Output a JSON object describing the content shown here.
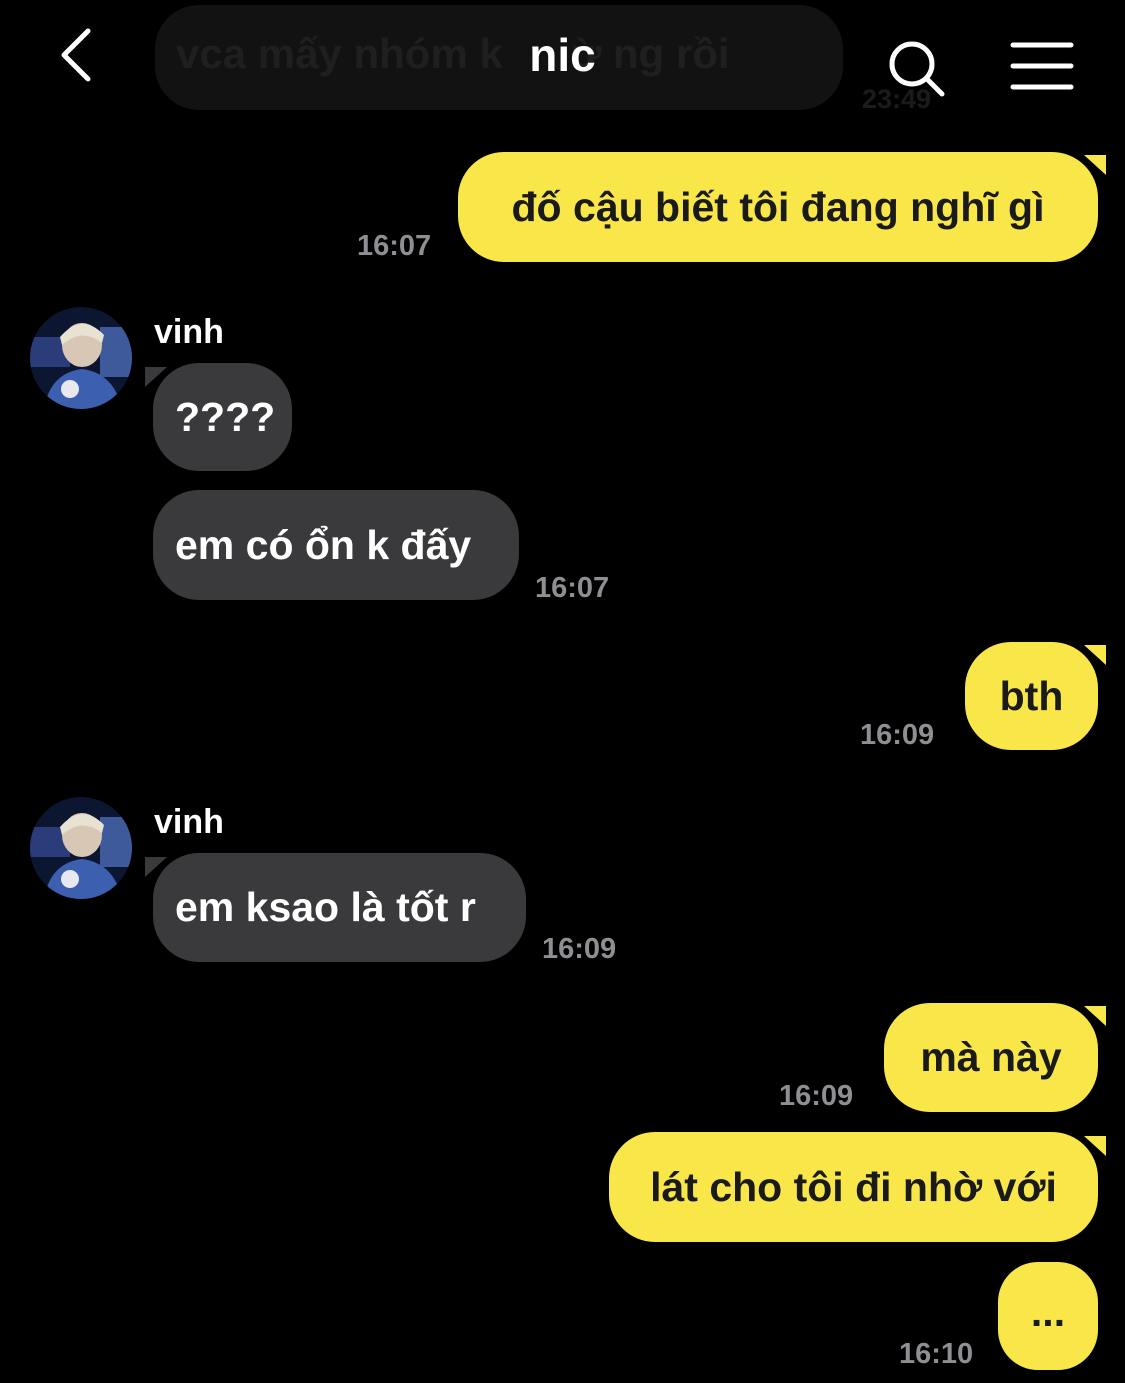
{
  "header": {
    "title": "nic",
    "background_preview_text": "vca mấy nhóm k",
    "background_preview_text_tail": "ừ ng rồi",
    "background_preview_time": "23:49"
  },
  "colors": {
    "outgoing_bubble": "#F9E74A",
    "incoming_bubble": "#3a3a3c",
    "timestamp": "#8e8e93",
    "background": "#000000"
  },
  "icons": {
    "back": "chevron-left-icon",
    "search": "search-icon",
    "menu": "hamburger-menu-icon"
  },
  "messages": [
    {
      "dir": "out",
      "text": "đố cậu biết tôi đang nghĩ gì",
      "time": "16:07"
    },
    {
      "dir": "in",
      "sender": "vinh",
      "text": "????"
    },
    {
      "dir": "in",
      "text": "em có ổn k đấy",
      "time": "16:07"
    },
    {
      "dir": "out",
      "text": "bth",
      "time": "16:09"
    },
    {
      "dir": "in",
      "sender": "vinh",
      "text": "em ksao là tốt r",
      "time": "16:09"
    },
    {
      "dir": "out",
      "text": "mà này",
      "time": "16:09"
    },
    {
      "dir": "out",
      "text": "lát cho tôi đi nhờ với"
    },
    {
      "dir": "out",
      "text": "...",
      "time": "16:10"
    }
  ]
}
